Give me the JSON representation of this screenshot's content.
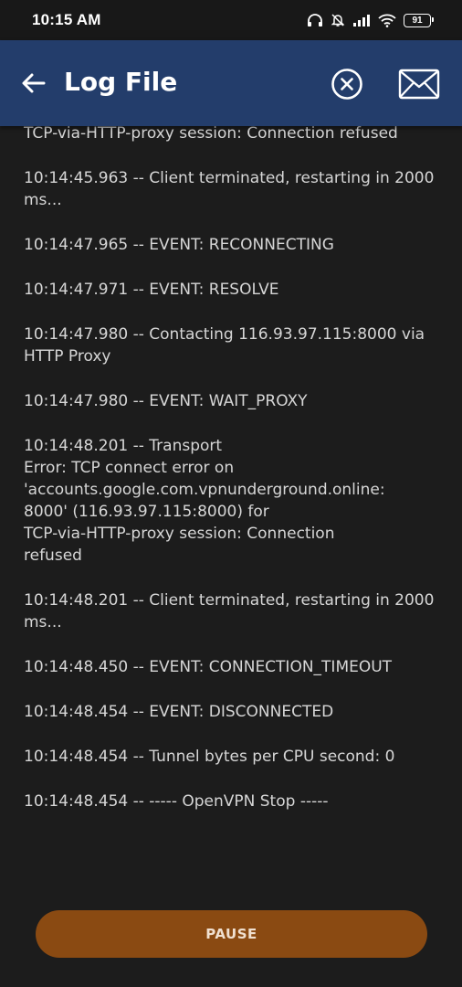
{
  "status_bar": {
    "time": "10:15 AM",
    "battery_level": "91",
    "icons": [
      "headphones-icon",
      "bell-muted-icon",
      "signal-icon",
      "wifi-icon",
      "battery-icon"
    ]
  },
  "app_bar": {
    "title": "Log File",
    "color": "#233d6b",
    "icons": [
      "back-arrow-icon",
      "clear-circle-x-icon",
      "mail-envelope-icon"
    ]
  },
  "log": {
    "entries": [
      "TCP-via-HTTP-proxy session: Connection refused",
      "10:14:45.963 -- Client terminated, restarting in 2000 ms...",
      "10:14:47.965 -- EVENT: RECONNECTING",
      "10:14:47.971 -- EVENT: RESOLVE",
      "10:14:47.980 -- Contacting 116.93.97.115:8000 via HTTP Proxy",
      "10:14:47.980 -- EVENT: WAIT_PROXY",
      "10:14:48.201 -- Transport\nError: TCP connect error on\n'accounts.google.com.vpnunderground.online:\n8000' (116.93.97.115:8000) for\nTCP-via-HTTP-proxy session: Connection\nrefused",
      "10:14:48.201 -- Client terminated, restarting in 2000 ms...",
      "10:14:48.450 -- EVENT: CONNECTION_TIMEOUT",
      "10:14:48.454 -- EVENT: DISCONNECTED",
      "10:14:48.454 -- Tunnel bytes per CPU second: 0",
      "10:14:48.454 -- ----- OpenVPN Stop -----"
    ]
  },
  "pause_button": {
    "label": "PAUSE",
    "color": "#8a4a12"
  }
}
